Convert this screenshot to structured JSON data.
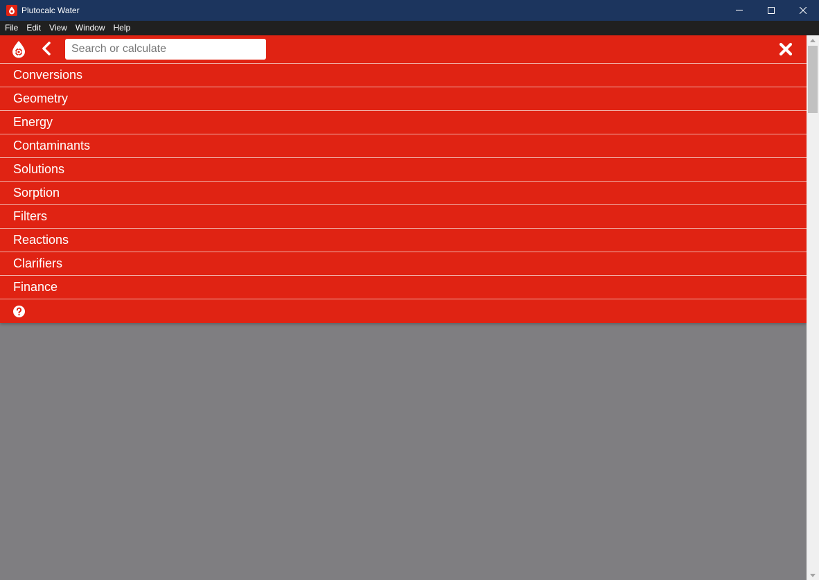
{
  "window": {
    "title": "Plutocalc Water",
    "controls": [
      "minimize-icon",
      "maximize-icon",
      "close-icon"
    ]
  },
  "menubar": {
    "items": [
      {
        "label": "File"
      },
      {
        "label": "Edit"
      },
      {
        "label": "View"
      },
      {
        "label": "Window"
      },
      {
        "label": "Help"
      }
    ]
  },
  "toolbar": {
    "logo_icon": "water-drop-gear-icon",
    "back_icon": "chevron-left-icon",
    "search": {
      "placeholder": "Search or calculate",
      "value": ""
    },
    "close_icon": "close-icon"
  },
  "categories": [
    {
      "label": "Conversions"
    },
    {
      "label": "Geometry"
    },
    {
      "label": "Energy"
    },
    {
      "label": "Contaminants"
    },
    {
      "label": "Solutions"
    },
    {
      "label": "Sorption"
    },
    {
      "label": "Filters"
    },
    {
      "label": "Reactions"
    },
    {
      "label": "Clarifiers"
    },
    {
      "label": "Finance"
    }
  ],
  "help_icon": "question-circle-icon",
  "colors": {
    "titlebar": "#1c355e",
    "menubar": "#202020",
    "accent": "#e02313",
    "background": "#7f7e81"
  }
}
